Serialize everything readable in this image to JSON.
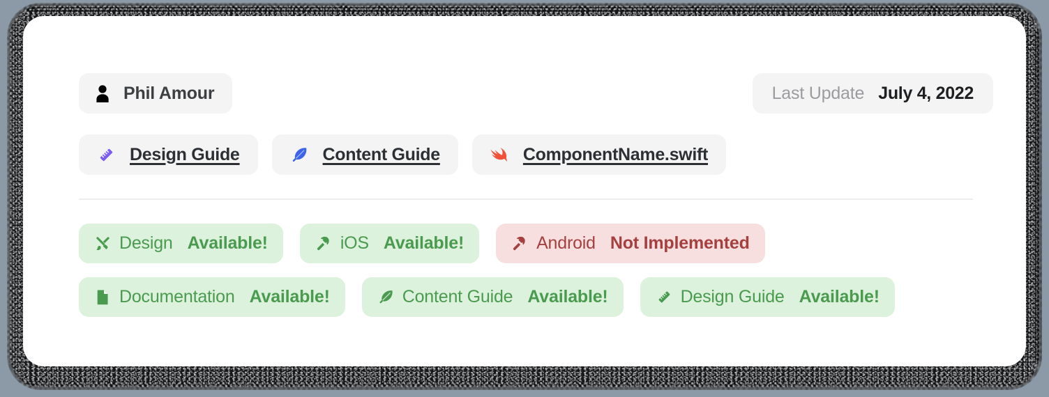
{
  "card": {
    "author": {
      "icon": "person-icon",
      "name": "Phil Amour"
    },
    "last_update": {
      "label": "Last Update",
      "value": "July 4, 2022"
    },
    "links": [
      {
        "icon": "ruler-icon",
        "label": "Design Guide"
      },
      {
        "icon": "feather-icon",
        "label": "Content Guide"
      },
      {
        "icon": "swift-bird-icon",
        "label": "ComponentName.swift"
      }
    ],
    "status_rows": [
      [
        {
          "icon": "paintbrush-pencil-icon",
          "label": "Design",
          "status": "Available!",
          "tone": "green"
        },
        {
          "icon": "hammer-icon",
          "label": "iOS",
          "status": "Available!",
          "tone": "green"
        },
        {
          "icon": "hammer-icon",
          "label": "Android",
          "status": "Not Implemented",
          "tone": "red"
        }
      ],
      [
        {
          "icon": "document-icon",
          "label": "Documentation",
          "status": "Available!",
          "tone": "green"
        },
        {
          "icon": "feather-icon",
          "label": "Content Guide",
          "status": "Available!",
          "tone": "green"
        },
        {
          "icon": "ruler-icon",
          "label": "Design Guide",
          "status": "Available!",
          "tone": "green"
        }
      ]
    ]
  },
  "colors": {
    "page_background": "#8b9aa6",
    "card_background": "#ffffff",
    "chip_background": "#f4f4f5",
    "green_badge_bg": "#dcf2dc",
    "green_text": "#4a9a4f",
    "red_badge_bg": "#f7dfdf",
    "red_text": "#a44040",
    "divider": "#ededef",
    "ruler_purple": "#7c5cf0",
    "feather_blue": "#3d63e8",
    "swift_orange": "#f05138"
  }
}
